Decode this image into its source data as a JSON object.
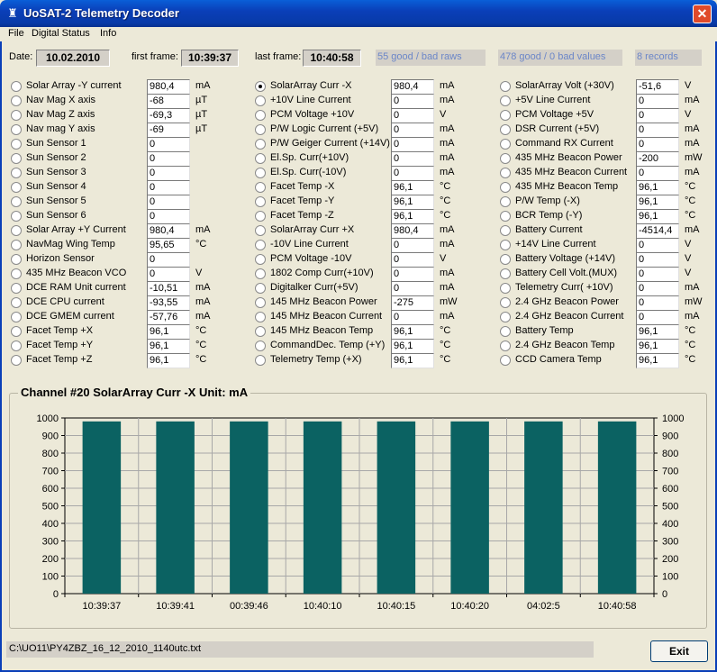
{
  "window": {
    "title": "UoSAT-2 Telemetry Decoder",
    "close": "✕",
    "icon": "♜"
  },
  "menu": [
    "File",
    "Digital Status",
    "Info"
  ],
  "header": {
    "date_label": "Date:",
    "date": "10.02.2010",
    "first_label": "first frame:",
    "first": "10:39:37",
    "last_label": "last frame:",
    "last": "10:40:58",
    "raws": "55 good /  bad raws",
    "values": "478 good / 0 bad values",
    "records": "8 records"
  },
  "channels": [
    [
      {
        "label": "Solar Array -Y current",
        "value": "980,4",
        "unit": "mA"
      },
      {
        "label": "Nav Mag X axis",
        "value": "-68",
        "unit": "µT"
      },
      {
        "label": "Nav Mag Z axis",
        "value": "-69,3",
        "unit": "µT"
      },
      {
        "label": "Nav mag Y axis",
        "value": "-69",
        "unit": "µT"
      },
      {
        "label": "Sun Sensor 1",
        "value": "0",
        "unit": ""
      },
      {
        "label": "Sun Sensor 2",
        "value": "0",
        "unit": ""
      },
      {
        "label": "Sun Sensor 3",
        "value": "0",
        "unit": ""
      },
      {
        "label": "Sun Sensor 4",
        "value": "0",
        "unit": ""
      },
      {
        "label": "Sun Sensor 5",
        "value": "0",
        "unit": ""
      },
      {
        "label": "Sun Sensor 6",
        "value": "0",
        "unit": ""
      },
      {
        "label": "Solar Array +Y Current",
        "value": "980,4",
        "unit": "mA"
      },
      {
        "label": "NavMag Wing Temp",
        "value": "95,65",
        "unit": "°C"
      },
      {
        "label": "Horizon Sensor",
        "value": "0",
        "unit": ""
      },
      {
        "label": "435 MHz Beacon VCO",
        "value": "0",
        "unit": "V"
      },
      {
        "label": "DCE RAM Unit current",
        "value": "-10,51",
        "unit": "mA"
      },
      {
        "label": "DCE CPU current",
        "value": "-93,55",
        "unit": "mA"
      },
      {
        "label": "DCE GMEM current",
        "value": "-57,76",
        "unit": "mA"
      },
      {
        "label": "Facet Temp +X",
        "value": "96,1",
        "unit": "°C"
      },
      {
        "label": "Facet Temp +Y",
        "value": "96,1",
        "unit": "°C"
      },
      {
        "label": "Facet Temp +Z",
        "value": "96,1",
        "unit": "°C"
      }
    ],
    [
      {
        "label": "SolarArray Curr -X",
        "value": "980,4",
        "unit": "mA",
        "selected": true
      },
      {
        "label": "+10V Line Current",
        "value": "0",
        "unit": "mA"
      },
      {
        "label": "PCM Voltage +10V",
        "value": "0",
        "unit": "V"
      },
      {
        "label": "P/W Logic Current (+5V)",
        "value": "0",
        "unit": "mA"
      },
      {
        "label": "P/W Geiger Current (+14V)",
        "value": "0",
        "unit": "mA"
      },
      {
        "label": "El.Sp. Curr(+10V)",
        "value": "0",
        "unit": "mA"
      },
      {
        "label": "El.Sp. Curr(-10V)",
        "value": "0",
        "unit": "mA"
      },
      {
        "label": "Facet Temp -X",
        "value": "96,1",
        "unit": "°C"
      },
      {
        "label": "Facet Temp -Y",
        "value": "96,1",
        "unit": "°C"
      },
      {
        "label": "Facet Temp -Z",
        "value": "96,1",
        "unit": "°C"
      },
      {
        "label": "SolarArray Curr +X",
        "value": "980,4",
        "unit": "mA"
      },
      {
        "label": "-10V Line Current",
        "value": "0",
        "unit": "mA"
      },
      {
        "label": "PCM Voltage -10V",
        "value": "0",
        "unit": "V"
      },
      {
        "label": "1802 Comp Curr(+10V)",
        "value": "0",
        "unit": "mA"
      },
      {
        "label": "Digitalker Curr(+5V)",
        "value": "0",
        "unit": "mA"
      },
      {
        "label": "145 MHz Beacon Power",
        "value": "-275",
        "unit": "mW"
      },
      {
        "label": "145 MHz Beacon Current",
        "value": "0",
        "unit": "mA"
      },
      {
        "label": "145 MHz Beacon Temp",
        "value": "96,1",
        "unit": "°C"
      },
      {
        "label": "CommandDec. Temp (+Y)",
        "value": "96,1",
        "unit": "°C"
      },
      {
        "label": "Telemetry Temp (+X)",
        "value": "96,1",
        "unit": "°C"
      }
    ],
    [
      {
        "label": "SolarArray Volt (+30V)",
        "value": "-51,6",
        "unit": "V"
      },
      {
        "label": "+5V Line Current",
        "value": "0",
        "unit": "mA"
      },
      {
        "label": "PCM Voltage +5V",
        "value": "0",
        "unit": "V"
      },
      {
        "label": "DSR Current (+5V)",
        "value": "0",
        "unit": "mA"
      },
      {
        "label": "Command RX Current",
        "value": "0",
        "unit": "mA"
      },
      {
        "label": "435 MHz Beacon Power",
        "value": "-200",
        "unit": "mW"
      },
      {
        "label": "435 MHz Beacon Current",
        "value": "0",
        "unit": "mA"
      },
      {
        "label": "435 MHz Beacon Temp",
        "value": "96,1",
        "unit": "°C"
      },
      {
        "label": "P/W Temp (-X)",
        "value": "96,1",
        "unit": "°C"
      },
      {
        "label": "BCR Temp (-Y)",
        "value": "96,1",
        "unit": "°C"
      },
      {
        "label": "Battery Current",
        "value": "-4514,4",
        "unit": "mA"
      },
      {
        "label": "+14V Line Current",
        "value": "0",
        "unit": "V"
      },
      {
        "label": "Battery Voltage (+14V)",
        "value": "0",
        "unit": "V"
      },
      {
        "label": "Battery Cell Volt.(MUX)",
        "value": "0",
        "unit": "V"
      },
      {
        "label": "Telemetry Curr( +10V)",
        "value": "0",
        "unit": "mA"
      },
      {
        "label": "2.4 GHz Beacon Power",
        "value": "0",
        "unit": "mW"
      },
      {
        "label": "2.4 GHz Beacon Current",
        "value": "0",
        "unit": "mA"
      },
      {
        "label": "Battery Temp",
        "value": "96,1",
        "unit": "°C"
      },
      {
        "label": "2.4 GHz Beacon Temp",
        "value": "96,1",
        "unit": "°C"
      },
      {
        "label": "CCD Camera Temp",
        "value": "96,1",
        "unit": "°C"
      }
    ]
  ],
  "chart_title": "Channel #20   SolarArray Curr -X   Unit: mA",
  "chart_data": {
    "type": "bar",
    "categories": [
      "10:39:37",
      "10:39:41",
      "00:39:46",
      "10:40:10",
      "10:40:15",
      "10:40:20",
      "04:02:5",
      "10:40:58"
    ],
    "values": [
      980.4,
      980.4,
      980.4,
      980.4,
      980.4,
      980.4,
      980.4,
      980.4
    ],
    "ylim": [
      0,
      1000
    ],
    "yticks": [
      "0",
      "100",
      "200",
      "300",
      "400",
      "500",
      "600",
      "700",
      "800",
      "900",
      "1000"
    ],
    "grid": true,
    "bar_color": "#0b6262"
  },
  "status_path": "C:\\UO11\\PY4ZBZ_16_12_2010_1140utc.txt",
  "exit_label": "Exit"
}
